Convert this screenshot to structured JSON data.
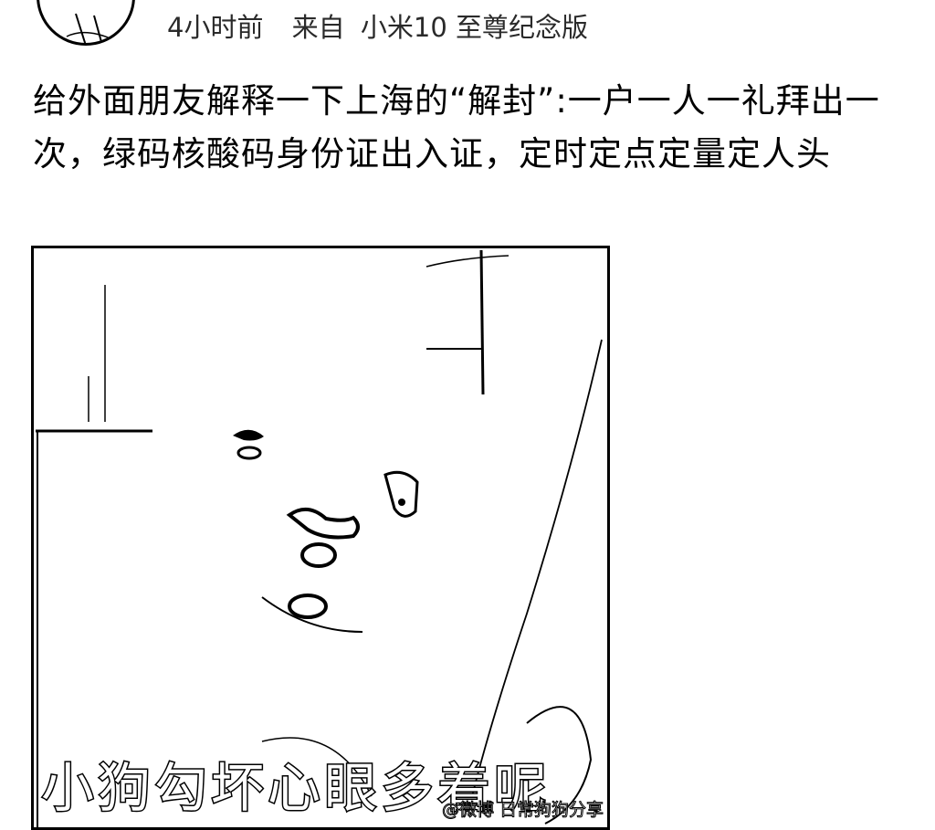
{
  "post": {
    "meta": {
      "time": "4小时前",
      "from_label": "来自",
      "device": "小米10 至尊纪念版"
    },
    "text": "给外面朋友解释一下上海的“解封”:一户一人一礼拜出一次，绿码核酸码身份证出入证，定时定点定量定人头",
    "image": {
      "caption": "小狗勾坏心眼多着呢",
      "watermark": "@微博 日常狗狗分享"
    }
  }
}
